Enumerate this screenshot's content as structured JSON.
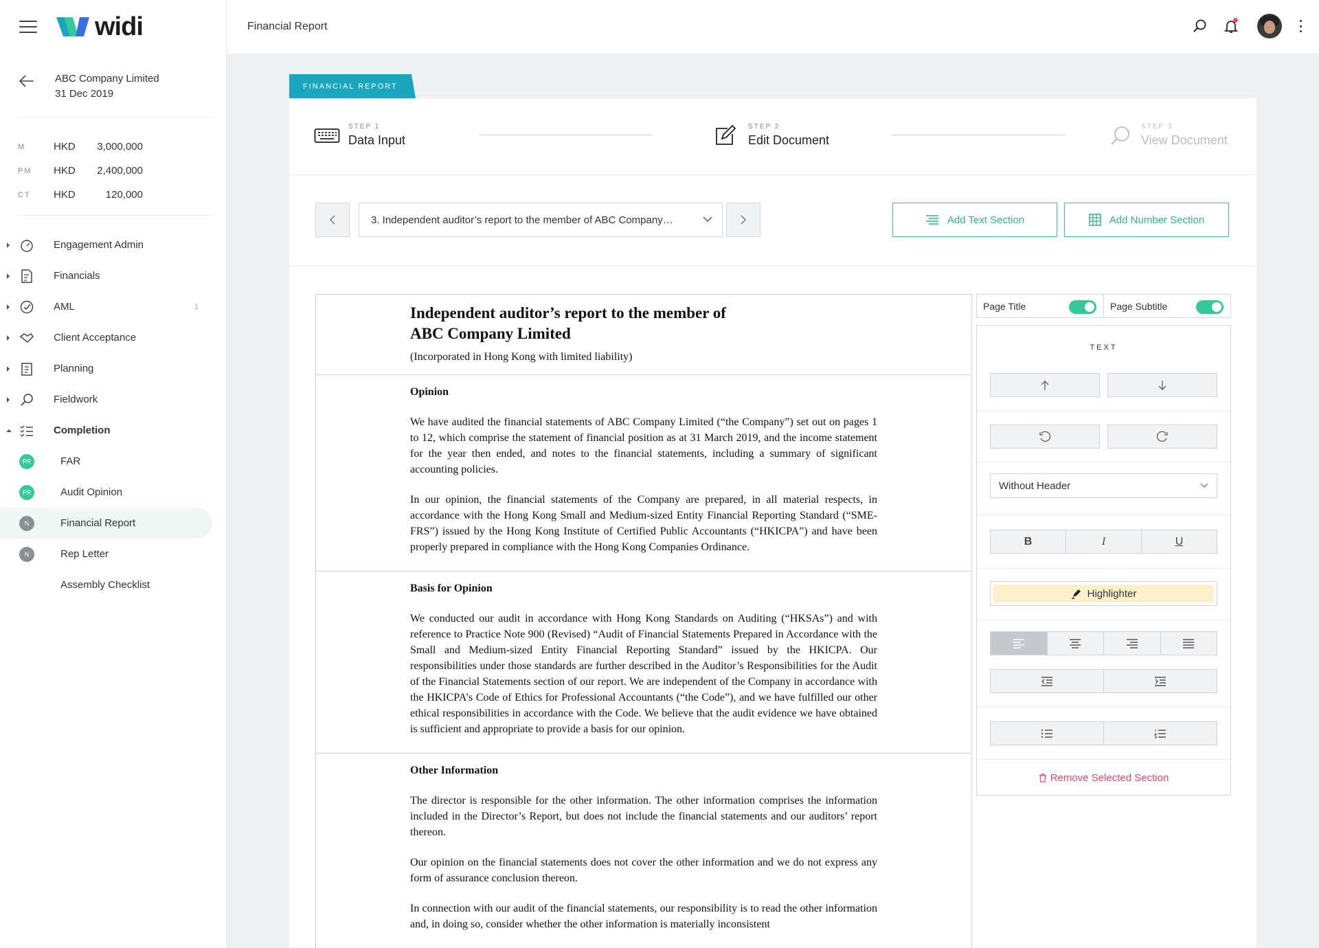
{
  "brand": {
    "name": "widi",
    "colors": {
      "teal": "#1aa6bf",
      "green": "#35c89b",
      "blue": "#3a6fe0",
      "pink": "#e0456a"
    }
  },
  "client": {
    "name": "ABC Company Limited",
    "date": "31 Dec 2019"
  },
  "materiality": [
    {
      "code": "M",
      "currency": "HKD",
      "value": "3,000,000"
    },
    {
      "code": "PM",
      "currency": "HKD",
      "value": "2,400,000"
    },
    {
      "code": "CT",
      "currency": "HKD",
      "value": "120,000"
    }
  ],
  "nav": {
    "items": [
      {
        "label": "Engagement Admin",
        "icon": "gauge-icon"
      },
      {
        "label": "Financials",
        "icon": "document-dollar-icon"
      },
      {
        "label": "AML",
        "icon": "check-circle-icon",
        "badge": "1"
      },
      {
        "label": "Client Acceptance",
        "icon": "handshake-icon"
      },
      {
        "label": "Planning",
        "icon": "clipboard-icon"
      },
      {
        "label": "Fieldwork",
        "icon": "magnifier-icon"
      },
      {
        "label": "Completion",
        "icon": "checklist-icon"
      }
    ],
    "sub_items": [
      {
        "label": "FAR",
        "badge": "PR"
      },
      {
        "label": "Audit Opinion",
        "badge": "PR"
      },
      {
        "label": "Financial Report",
        "badge": "N",
        "active": true
      },
      {
        "label": "Rep Letter",
        "badge": "N"
      },
      {
        "label": "Assembly Checklist",
        "badge": ""
      }
    ]
  },
  "topbar": {
    "title": "Financial Report",
    "icons": [
      "search-icon",
      "bell-icon",
      "avatar",
      "more-vertical-icon"
    ]
  },
  "tab_flag": "FINANCIAL REPORT",
  "steps": [
    {
      "sub": "STEP 1",
      "name": "Data Input",
      "icon": "keyboard-icon"
    },
    {
      "sub": "STEP 2",
      "name": "Edit Document",
      "icon": "edit-icon"
    },
    {
      "sub": "STEP 3",
      "name": "View Document",
      "icon": "magnifier-icon"
    }
  ],
  "toolbar": {
    "section_select": "3. Independent auditor’s report to the member of ABC Company…",
    "add_text": "Add Text Section",
    "add_number": "Add Number Section"
  },
  "document": {
    "title_line1": "Independent auditor’s report to the member of",
    "title_line2": "ABC Company Limited",
    "subtitle": "(Incorporated in Hong Kong with limited liability)",
    "sections": [
      {
        "heading": "Opinion",
        "paragraphs": [
          "We have audited the financial statements of ABC Company Limited (“the Company”) set out on pages 1 to 12, which comprise the statement of financial position as at 31 March 2019, and the income statement for the year then ended, and notes to the financial statements, including a summary of significant accounting policies.",
          "In our opinion, the financial statements of the Company are prepared, in all material respects, in accordance with the Hong Kong Small and Medium-sized Entity Financial Reporting Standard (“SME-FRS”) issued by the Hong Kong Institute of Certified Public Accountants (“HKICPA”) and have been properly prepared in compliance with the Hong Kong Companies Ordinance."
        ]
      },
      {
        "heading": "Basis for Opinion",
        "paragraphs": [
          "We conducted our audit in accordance with Hong Kong Standards on Auditing (“HKSAs”) and with reference to Practice Note 900 (Revised) “Audit of Financial Statements Prepared in Accordance with the Small and Medium-sized Entity Financial Reporting Standard” issued by the HKICPA. Our responsibilities under those standards are further described in the Auditor’s Responsibilities for the Audit of the Financial Statements section of our report. We are independent of the Company in accordance with the HKICPA’s Code of Ethics for Professional Accountants (“the Code”), and we have fulfilled our other ethical responsibilities in accordance with the Code. We believe that the audit evidence we have obtained is sufficient and appropriate to provide a basis for our opinion."
        ]
      },
      {
        "heading": "Other Information",
        "paragraphs": [
          "The director is responsible for the other information. The other information comprises the information included in the Director’s Report, but does not include the financial statements and our auditors’ report thereon.",
          "Our opinion on the financial statements does not cover the other information and we do not express any form of assurance conclusion thereon.",
          "In connection with our audit of the financial statements, our responsibility is to read the other information and, in doing so, consider whether the other information is materially inconsistent"
        ]
      }
    ]
  },
  "panel": {
    "page_title": "Page Title",
    "page_subtitle": "Page Subtitle",
    "page_title_on": true,
    "page_subtitle_on": true,
    "label": "TEXT",
    "header_option": "Without Header",
    "bold": "B",
    "italic": "I",
    "underline": "U",
    "highlighter": "Highlighter",
    "remove": "Remove Selected Section"
  }
}
